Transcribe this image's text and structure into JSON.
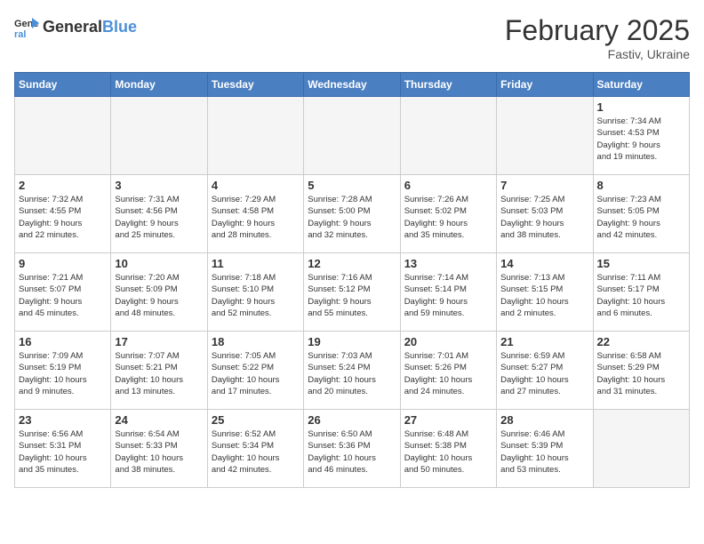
{
  "header": {
    "logo_general": "General",
    "logo_blue": "Blue",
    "title": "February 2025",
    "subtitle": "Fastiv, Ukraine"
  },
  "days_of_week": [
    "Sunday",
    "Monday",
    "Tuesday",
    "Wednesday",
    "Thursday",
    "Friday",
    "Saturday"
  ],
  "weeks": [
    [
      {
        "day": "",
        "info": "",
        "empty": true
      },
      {
        "day": "",
        "info": "",
        "empty": true
      },
      {
        "day": "",
        "info": "",
        "empty": true
      },
      {
        "day": "",
        "info": "",
        "empty": true
      },
      {
        "day": "",
        "info": "",
        "empty": true
      },
      {
        "day": "",
        "info": "",
        "empty": true
      },
      {
        "day": "1",
        "info": "Sunrise: 7:34 AM\nSunset: 4:53 PM\nDaylight: 9 hours\nand 19 minutes."
      }
    ],
    [
      {
        "day": "2",
        "info": "Sunrise: 7:32 AM\nSunset: 4:55 PM\nDaylight: 9 hours\nand 22 minutes."
      },
      {
        "day": "3",
        "info": "Sunrise: 7:31 AM\nSunset: 4:56 PM\nDaylight: 9 hours\nand 25 minutes."
      },
      {
        "day": "4",
        "info": "Sunrise: 7:29 AM\nSunset: 4:58 PM\nDaylight: 9 hours\nand 28 minutes."
      },
      {
        "day": "5",
        "info": "Sunrise: 7:28 AM\nSunset: 5:00 PM\nDaylight: 9 hours\nand 32 minutes."
      },
      {
        "day": "6",
        "info": "Sunrise: 7:26 AM\nSunset: 5:02 PM\nDaylight: 9 hours\nand 35 minutes."
      },
      {
        "day": "7",
        "info": "Sunrise: 7:25 AM\nSunset: 5:03 PM\nDaylight: 9 hours\nand 38 minutes."
      },
      {
        "day": "8",
        "info": "Sunrise: 7:23 AM\nSunset: 5:05 PM\nDaylight: 9 hours\nand 42 minutes."
      }
    ],
    [
      {
        "day": "9",
        "info": "Sunrise: 7:21 AM\nSunset: 5:07 PM\nDaylight: 9 hours\nand 45 minutes."
      },
      {
        "day": "10",
        "info": "Sunrise: 7:20 AM\nSunset: 5:09 PM\nDaylight: 9 hours\nand 48 minutes."
      },
      {
        "day": "11",
        "info": "Sunrise: 7:18 AM\nSunset: 5:10 PM\nDaylight: 9 hours\nand 52 minutes."
      },
      {
        "day": "12",
        "info": "Sunrise: 7:16 AM\nSunset: 5:12 PM\nDaylight: 9 hours\nand 55 minutes."
      },
      {
        "day": "13",
        "info": "Sunrise: 7:14 AM\nSunset: 5:14 PM\nDaylight: 9 hours\nand 59 minutes."
      },
      {
        "day": "14",
        "info": "Sunrise: 7:13 AM\nSunset: 5:15 PM\nDaylight: 10 hours\nand 2 minutes."
      },
      {
        "day": "15",
        "info": "Sunrise: 7:11 AM\nSunset: 5:17 PM\nDaylight: 10 hours\nand 6 minutes."
      }
    ],
    [
      {
        "day": "16",
        "info": "Sunrise: 7:09 AM\nSunset: 5:19 PM\nDaylight: 10 hours\nand 9 minutes."
      },
      {
        "day": "17",
        "info": "Sunrise: 7:07 AM\nSunset: 5:21 PM\nDaylight: 10 hours\nand 13 minutes."
      },
      {
        "day": "18",
        "info": "Sunrise: 7:05 AM\nSunset: 5:22 PM\nDaylight: 10 hours\nand 17 minutes."
      },
      {
        "day": "19",
        "info": "Sunrise: 7:03 AM\nSunset: 5:24 PM\nDaylight: 10 hours\nand 20 minutes."
      },
      {
        "day": "20",
        "info": "Sunrise: 7:01 AM\nSunset: 5:26 PM\nDaylight: 10 hours\nand 24 minutes."
      },
      {
        "day": "21",
        "info": "Sunrise: 6:59 AM\nSunset: 5:27 PM\nDaylight: 10 hours\nand 27 minutes."
      },
      {
        "day": "22",
        "info": "Sunrise: 6:58 AM\nSunset: 5:29 PM\nDaylight: 10 hours\nand 31 minutes."
      }
    ],
    [
      {
        "day": "23",
        "info": "Sunrise: 6:56 AM\nSunset: 5:31 PM\nDaylight: 10 hours\nand 35 minutes."
      },
      {
        "day": "24",
        "info": "Sunrise: 6:54 AM\nSunset: 5:33 PM\nDaylight: 10 hours\nand 38 minutes."
      },
      {
        "day": "25",
        "info": "Sunrise: 6:52 AM\nSunset: 5:34 PM\nDaylight: 10 hours\nand 42 minutes."
      },
      {
        "day": "26",
        "info": "Sunrise: 6:50 AM\nSunset: 5:36 PM\nDaylight: 10 hours\nand 46 minutes."
      },
      {
        "day": "27",
        "info": "Sunrise: 6:48 AM\nSunset: 5:38 PM\nDaylight: 10 hours\nand 50 minutes."
      },
      {
        "day": "28",
        "info": "Sunrise: 6:46 AM\nSunset: 5:39 PM\nDaylight: 10 hours\nand 53 minutes."
      },
      {
        "day": "",
        "info": "",
        "empty": true
      }
    ]
  ]
}
